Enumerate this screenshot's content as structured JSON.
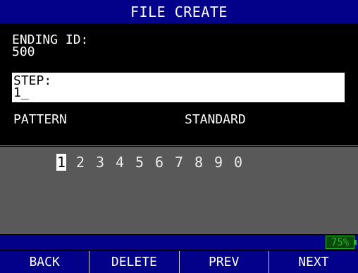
{
  "title": "FILE CREATE",
  "ending_id": {
    "label": "ENDING ID:",
    "value": "500"
  },
  "step": {
    "label": "STEP:",
    "value": "1",
    "cursor": "_"
  },
  "pattern": {
    "label": "PATTERN",
    "value": "STANDARD"
  },
  "keypad": {
    "digits": [
      "1",
      "2",
      "3",
      "4",
      "5",
      "6",
      "7",
      "8",
      "9",
      "0"
    ],
    "selected_index": 0
  },
  "status": {
    "battery": "75%"
  },
  "softkeys": {
    "back": "BACK",
    "delete": "DELETE",
    "prev": "PREV",
    "next": "NEXT"
  },
  "colors": {
    "bar_blue": "#03008a",
    "battery_green": "#2bb52b",
    "keypad_gray": "#595959"
  }
}
